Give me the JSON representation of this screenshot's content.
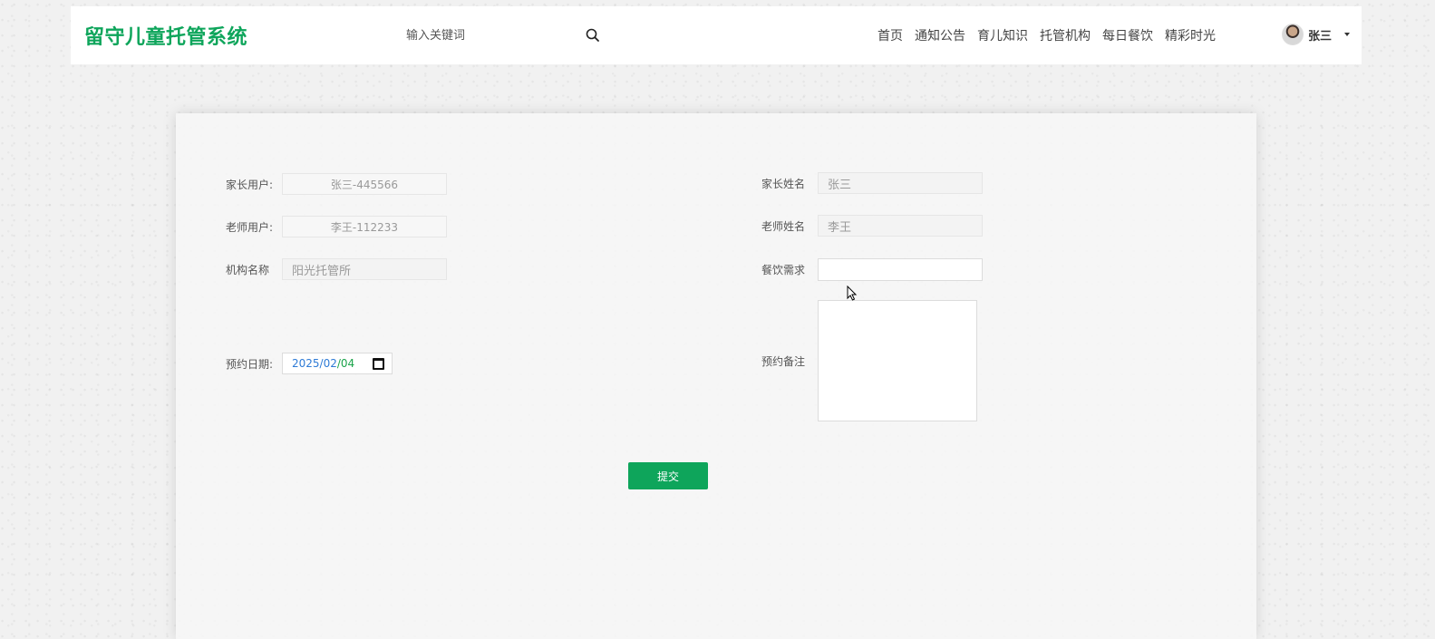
{
  "header": {
    "logo": "留守儿童托管系统",
    "search_placeholder": "输入关键词",
    "nav": [
      "首页",
      "通知公告",
      "育儿知识",
      "托管机构",
      "每日餐饮",
      "精彩时光"
    ],
    "user_name": "张三"
  },
  "form": {
    "parent_user_label": "家长用户:",
    "parent_user_value": "张三-445566",
    "parent_name_label": "家长姓名",
    "parent_name_value": "张三",
    "teacher_user_label": "老师用户:",
    "teacher_user_value": "李王-112233",
    "teacher_name_label": "老师姓名",
    "teacher_name_value": "李王",
    "institution_label": "机构名称",
    "institution_value": "阳光托管所",
    "meal_label": "餐饮需求",
    "meal_value": "",
    "date_label": "预约日期:",
    "date_year": "2025",
    "date_month": "02",
    "date_day": "04",
    "date_sep": "/",
    "remark_label": "预约备注",
    "remark_value": "",
    "submit_label": "提交"
  },
  "colors": {
    "brand": "#0ea55b",
    "date_year_month": "#2e7bd6",
    "date_day": "#1aa34a"
  },
  "icons": [
    "search-icon",
    "chevron-down-icon",
    "calendar-icon",
    "cursor-icon"
  ]
}
